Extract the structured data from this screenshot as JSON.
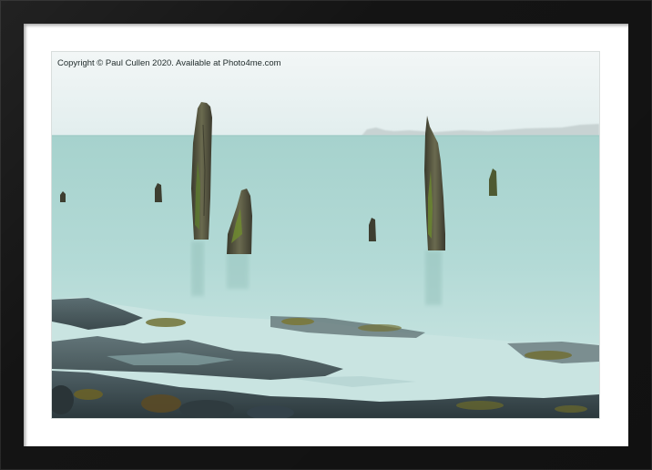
{
  "framed_print": {
    "frame_color": "#141414",
    "mount_color": "#ffffff",
    "photo": {
      "subject": "weathered wooden posts in misty long-exposure sea",
      "watermark_text": "Copyright  © Paul Cullen  2020. Available at Photo4me.com",
      "sky_color": "#e9f1f1",
      "sea_color": "#a9d3cf",
      "rock_color": "#3a4a4f",
      "seaweed_color": "#6b6a2a"
    }
  }
}
